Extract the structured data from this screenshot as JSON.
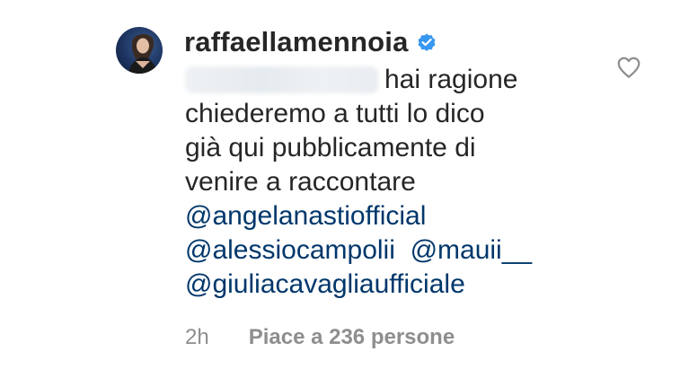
{
  "comment": {
    "username": "raffaellamennoia",
    "verified": true,
    "text_lines": [
      "hai ragione",
      "chiederemo a tutti lo dico",
      "già qui pubblicamente di",
      "venire a raccontare"
    ],
    "mentions": {
      "line1": "@angelanastiofficial",
      "line2a": "@alessiocampolii",
      "line2b": "@mauii__",
      "line3": "@giuliacavagliaufficiale"
    },
    "timestamp": "2h",
    "likes": "Piace a 236 persone"
  },
  "colors": {
    "text": "#262626",
    "mention": "#00376b",
    "meta": "#8e8e8e",
    "verified": "#3897f0"
  },
  "icons": {
    "verified": "verified-badge-icon",
    "like": "heart-outline-icon"
  }
}
